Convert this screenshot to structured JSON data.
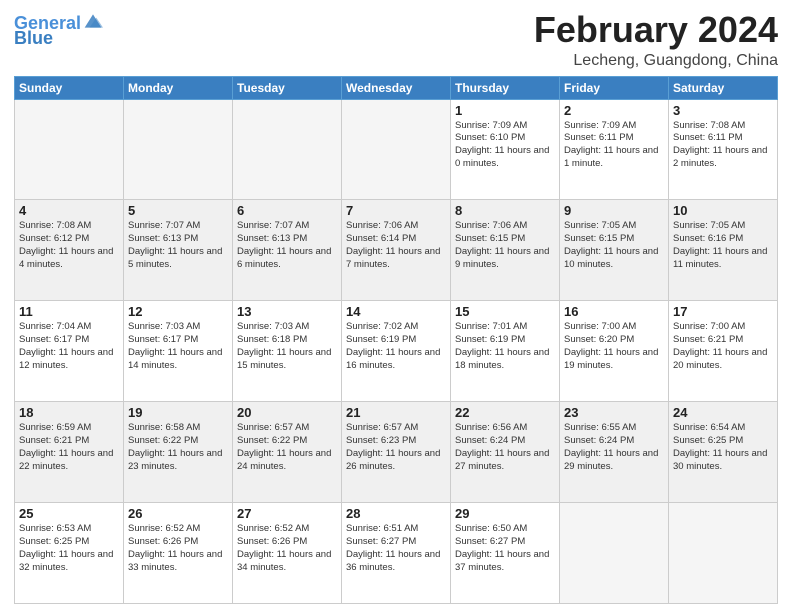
{
  "header": {
    "logo_text1": "General",
    "logo_text2": "Blue",
    "month": "February 2024",
    "location": "Lecheng, Guangdong, China"
  },
  "weekdays": [
    "Sunday",
    "Monday",
    "Tuesday",
    "Wednesday",
    "Thursday",
    "Friday",
    "Saturday"
  ],
  "weeks": [
    [
      {
        "day": "",
        "empty": true
      },
      {
        "day": "",
        "empty": true
      },
      {
        "day": "",
        "empty": true
      },
      {
        "day": "",
        "empty": true
      },
      {
        "day": "1",
        "sunrise": "Sunrise: 7:09 AM",
        "sunset": "Sunset: 6:10 PM",
        "daylight": "Daylight: 11 hours and 0 minutes."
      },
      {
        "day": "2",
        "sunrise": "Sunrise: 7:09 AM",
        "sunset": "Sunset: 6:11 PM",
        "daylight": "Daylight: 11 hours and 1 minute."
      },
      {
        "day": "3",
        "sunrise": "Sunrise: 7:08 AM",
        "sunset": "Sunset: 6:11 PM",
        "daylight": "Daylight: 11 hours and 2 minutes."
      }
    ],
    [
      {
        "day": "4",
        "sunrise": "Sunrise: 7:08 AM",
        "sunset": "Sunset: 6:12 PM",
        "daylight": "Daylight: 11 hours and 4 minutes."
      },
      {
        "day": "5",
        "sunrise": "Sunrise: 7:07 AM",
        "sunset": "Sunset: 6:13 PM",
        "daylight": "Daylight: 11 hours and 5 minutes."
      },
      {
        "day": "6",
        "sunrise": "Sunrise: 7:07 AM",
        "sunset": "Sunset: 6:13 PM",
        "daylight": "Daylight: 11 hours and 6 minutes."
      },
      {
        "day": "7",
        "sunrise": "Sunrise: 7:06 AM",
        "sunset": "Sunset: 6:14 PM",
        "daylight": "Daylight: 11 hours and 7 minutes."
      },
      {
        "day": "8",
        "sunrise": "Sunrise: 7:06 AM",
        "sunset": "Sunset: 6:15 PM",
        "daylight": "Daylight: 11 hours and 9 minutes."
      },
      {
        "day": "9",
        "sunrise": "Sunrise: 7:05 AM",
        "sunset": "Sunset: 6:15 PM",
        "daylight": "Daylight: 11 hours and 10 minutes."
      },
      {
        "day": "10",
        "sunrise": "Sunrise: 7:05 AM",
        "sunset": "Sunset: 6:16 PM",
        "daylight": "Daylight: 11 hours and 11 minutes."
      }
    ],
    [
      {
        "day": "11",
        "sunrise": "Sunrise: 7:04 AM",
        "sunset": "Sunset: 6:17 PM",
        "daylight": "Daylight: 11 hours and 12 minutes."
      },
      {
        "day": "12",
        "sunrise": "Sunrise: 7:03 AM",
        "sunset": "Sunset: 6:17 PM",
        "daylight": "Daylight: 11 hours and 14 minutes."
      },
      {
        "day": "13",
        "sunrise": "Sunrise: 7:03 AM",
        "sunset": "Sunset: 6:18 PM",
        "daylight": "Daylight: 11 hours and 15 minutes."
      },
      {
        "day": "14",
        "sunrise": "Sunrise: 7:02 AM",
        "sunset": "Sunset: 6:19 PM",
        "daylight": "Daylight: 11 hours and 16 minutes."
      },
      {
        "day": "15",
        "sunrise": "Sunrise: 7:01 AM",
        "sunset": "Sunset: 6:19 PM",
        "daylight": "Daylight: 11 hours and 18 minutes."
      },
      {
        "day": "16",
        "sunrise": "Sunrise: 7:00 AM",
        "sunset": "Sunset: 6:20 PM",
        "daylight": "Daylight: 11 hours and 19 minutes."
      },
      {
        "day": "17",
        "sunrise": "Sunrise: 7:00 AM",
        "sunset": "Sunset: 6:21 PM",
        "daylight": "Daylight: 11 hours and 20 minutes."
      }
    ],
    [
      {
        "day": "18",
        "sunrise": "Sunrise: 6:59 AM",
        "sunset": "Sunset: 6:21 PM",
        "daylight": "Daylight: 11 hours and 22 minutes."
      },
      {
        "day": "19",
        "sunrise": "Sunrise: 6:58 AM",
        "sunset": "Sunset: 6:22 PM",
        "daylight": "Daylight: 11 hours and 23 minutes."
      },
      {
        "day": "20",
        "sunrise": "Sunrise: 6:57 AM",
        "sunset": "Sunset: 6:22 PM",
        "daylight": "Daylight: 11 hours and 24 minutes."
      },
      {
        "day": "21",
        "sunrise": "Sunrise: 6:57 AM",
        "sunset": "Sunset: 6:23 PM",
        "daylight": "Daylight: 11 hours and 26 minutes."
      },
      {
        "day": "22",
        "sunrise": "Sunrise: 6:56 AM",
        "sunset": "Sunset: 6:24 PM",
        "daylight": "Daylight: 11 hours and 27 minutes."
      },
      {
        "day": "23",
        "sunrise": "Sunrise: 6:55 AM",
        "sunset": "Sunset: 6:24 PM",
        "daylight": "Daylight: 11 hours and 29 minutes."
      },
      {
        "day": "24",
        "sunrise": "Sunrise: 6:54 AM",
        "sunset": "Sunset: 6:25 PM",
        "daylight": "Daylight: 11 hours and 30 minutes."
      }
    ],
    [
      {
        "day": "25",
        "sunrise": "Sunrise: 6:53 AM",
        "sunset": "Sunset: 6:25 PM",
        "daylight": "Daylight: 11 hours and 32 minutes."
      },
      {
        "day": "26",
        "sunrise": "Sunrise: 6:52 AM",
        "sunset": "Sunset: 6:26 PM",
        "daylight": "Daylight: 11 hours and 33 minutes."
      },
      {
        "day": "27",
        "sunrise": "Sunrise: 6:52 AM",
        "sunset": "Sunset: 6:26 PM",
        "daylight": "Daylight: 11 hours and 34 minutes."
      },
      {
        "day": "28",
        "sunrise": "Sunrise: 6:51 AM",
        "sunset": "Sunset: 6:27 PM",
        "daylight": "Daylight: 11 hours and 36 minutes."
      },
      {
        "day": "29",
        "sunrise": "Sunrise: 6:50 AM",
        "sunset": "Sunset: 6:27 PM",
        "daylight": "Daylight: 11 hours and 37 minutes."
      },
      {
        "day": "",
        "empty": true
      },
      {
        "day": "",
        "empty": true
      }
    ]
  ]
}
